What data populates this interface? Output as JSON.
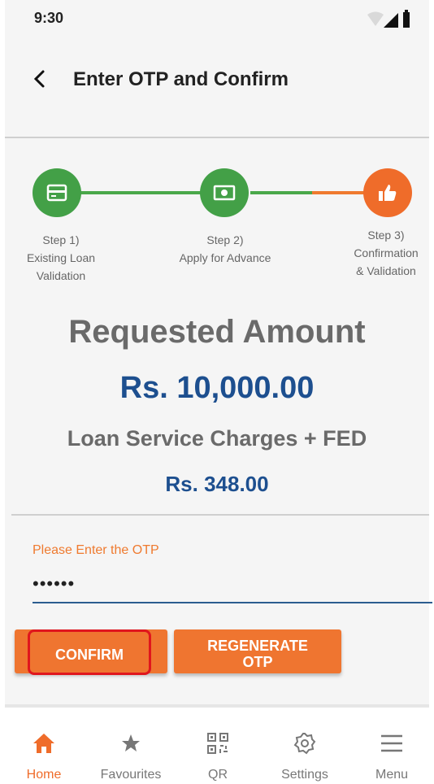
{
  "status_bar": {
    "time": "9:30"
  },
  "header": {
    "title": "Enter OTP and Confirm"
  },
  "stepper": {
    "steps": [
      {
        "line1": "Step 1)",
        "line2": "Existing Loan",
        "line3": "Validation",
        "state": "done"
      },
      {
        "line1": "Step 2)",
        "line2": "Apply for Advance",
        "line3": "",
        "state": "done"
      },
      {
        "line1": "Step 3)",
        "line2": "Confirmation",
        "line3": "& Validation",
        "state": "current"
      }
    ]
  },
  "amounts": {
    "requested_title": "Requested Amount",
    "requested_value": "Rs. 10,000.00",
    "charges_title": "Loan Service Charges + FED",
    "charges_value": "Rs. 348.00"
  },
  "otp": {
    "label": "Please Enter the OTP",
    "value": "••••••"
  },
  "buttons": {
    "confirm": "CONFIRM",
    "regenerate_line1": "REGENERATE",
    "regenerate_line2": "OTP"
  },
  "bottom_nav": {
    "items": [
      {
        "label": "Home",
        "icon": "home-icon",
        "active": true
      },
      {
        "label": "Favourites",
        "icon": "star-icon",
        "active": false
      },
      {
        "label": "QR",
        "icon": "qr-icon",
        "active": false
      },
      {
        "label": "Settings",
        "icon": "gear-icon",
        "active": false
      },
      {
        "label": "Menu",
        "icon": "menu-icon",
        "active": false
      }
    ]
  },
  "colors": {
    "accent": "#ef7530",
    "success": "#43a047",
    "amount_blue": "#1d4f8f"
  }
}
